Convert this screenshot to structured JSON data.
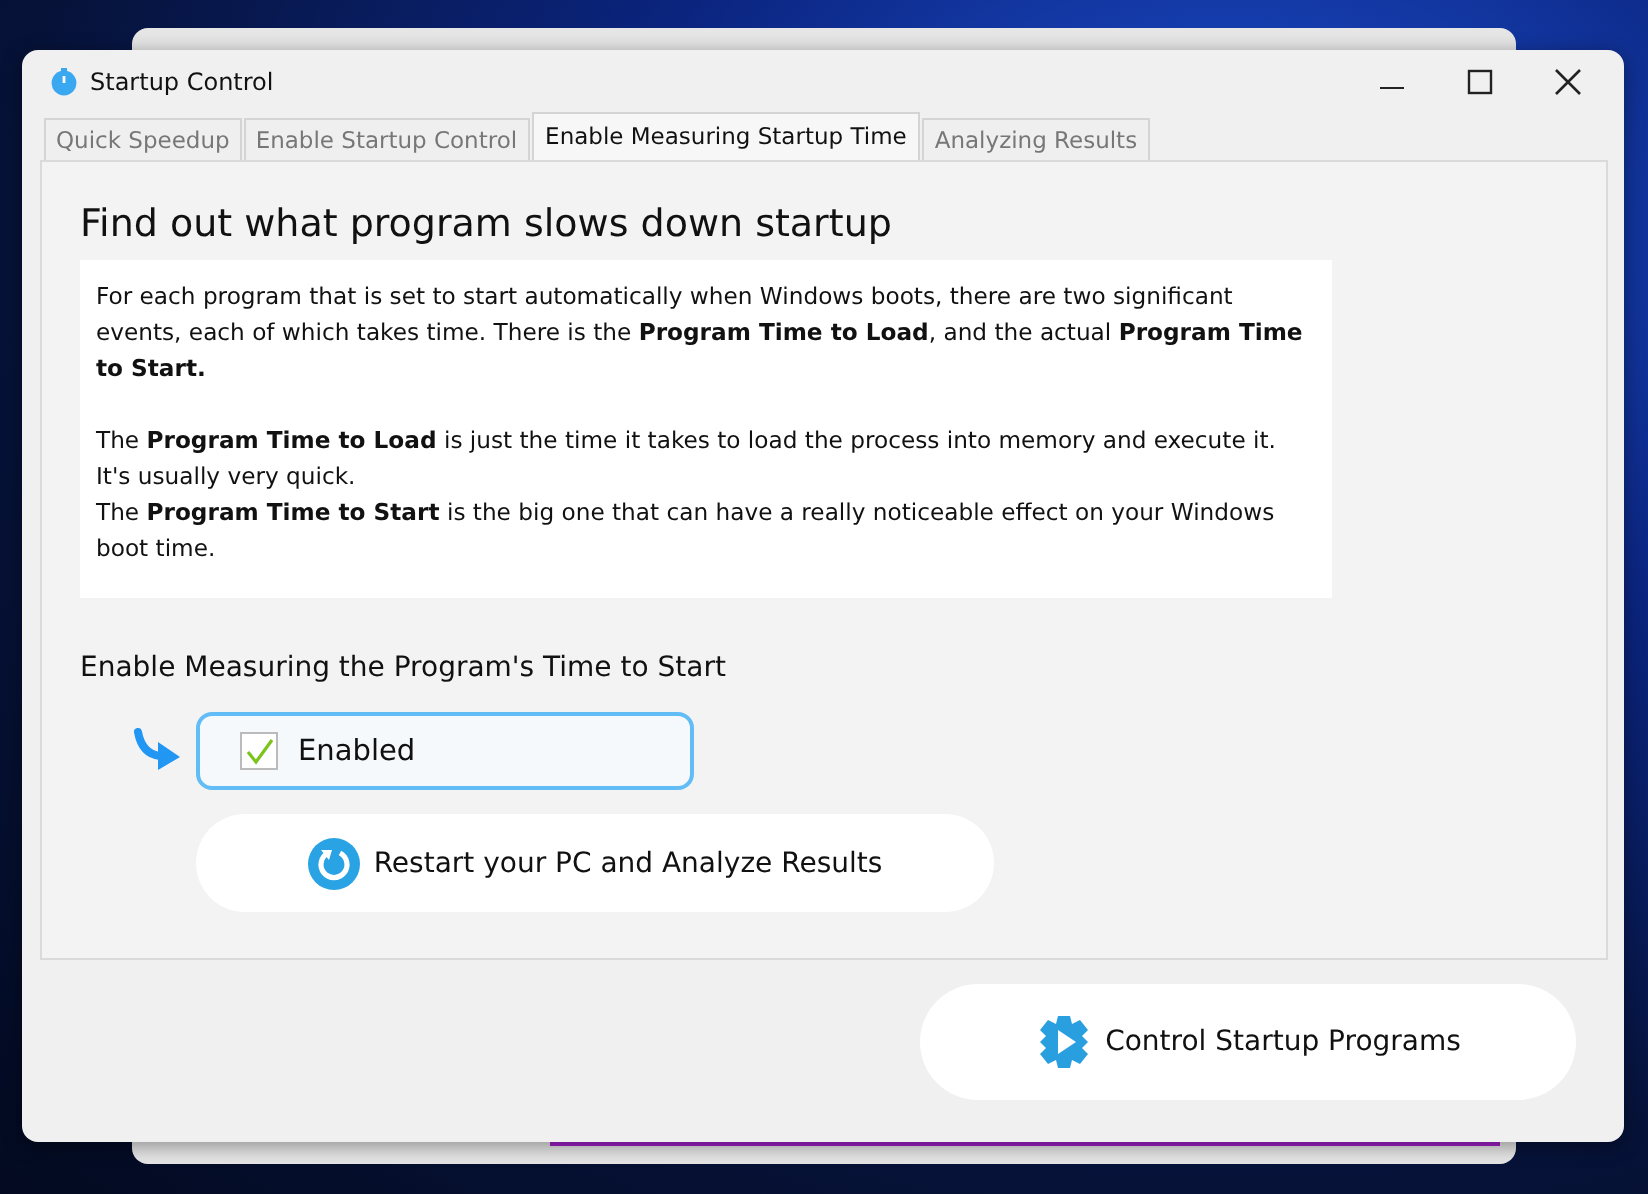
{
  "window": {
    "title": "Startup Control"
  },
  "tabs": [
    {
      "label": "Quick Speedup",
      "selected": false
    },
    {
      "label": "Enable Startup Control",
      "selected": false
    },
    {
      "label": "Enable Measuring Startup Time",
      "selected": true
    },
    {
      "label": "Analyzing Results",
      "selected": false
    }
  ],
  "heading": "Find out what program slows down startup",
  "info_paragraphs": [
    "For each program that is set to start automatically when Windows boots, there are two significant events, each of which takes time.  There is the **Program Time to Load**, and the actual **Program Time to Start.**",
    "The **Program Time to Load** is just the time it takes to load the process into memory and execute it. It's usually very quick.",
    "The **Program Time to Start** is the big one that can have a really noticeable effect on your Windows boot time."
  ],
  "option_label": "Enable Measuring the Program's Time to Start",
  "checkbox": {
    "label": "Enabled",
    "checked": true
  },
  "restart_button": "Restart your PC and Analyze Results",
  "control_button": "Control Startup Programs"
}
